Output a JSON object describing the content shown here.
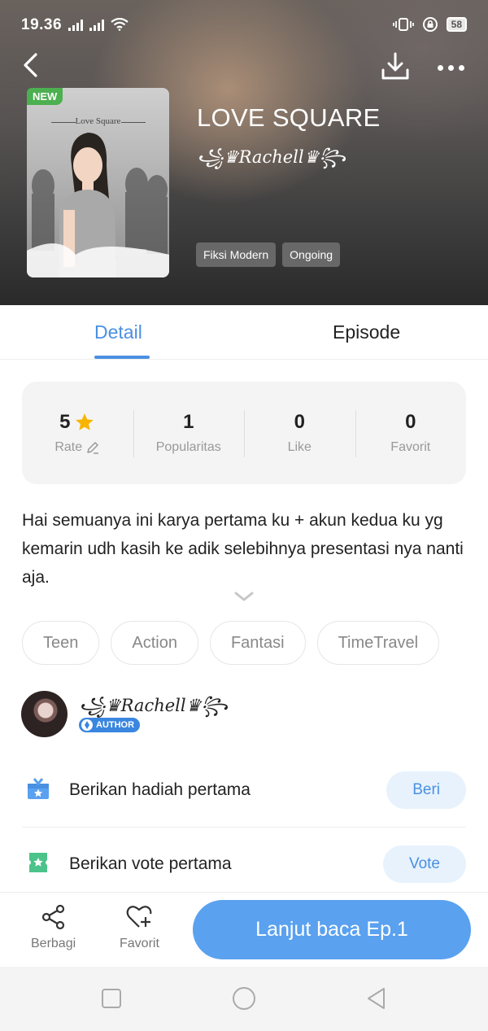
{
  "status_bar": {
    "time": "19.36",
    "battery": "58"
  },
  "header": {
    "back_icon": "chevron-left-icon",
    "download_icon": "download-icon",
    "more_icon": "more-horizontal-icon",
    "new_badge": "NEW",
    "cover_text": "Love Square",
    "title": "LOVE SQUARE",
    "author": "꧁♛Rachell♛꧂",
    "tags": [
      "Fiksi Modern",
      "Ongoing"
    ]
  },
  "tabs": [
    {
      "label": "Detail",
      "active": true
    },
    {
      "label": "Episode",
      "active": false
    }
  ],
  "stats": [
    {
      "value": "5",
      "label": "Rate",
      "icon": "star-icon"
    },
    {
      "value": "1",
      "label": "Popularitas"
    },
    {
      "value": "0",
      "label": "Like"
    },
    {
      "value": "0",
      "label": "Favorit"
    }
  ],
  "description": "Hai semuanya ini karya pertama ku + akun kedua ku yg kemarin udh kasih ke adik selebihnya presentasi nya nanti aja.",
  "genres": [
    "Teen",
    "Action",
    "Fantasi",
    "TimeTravel"
  ],
  "author": {
    "name": "꧁♛Rachell♛꧂",
    "badge": "AUTHOR"
  },
  "actions": [
    {
      "label": "Berikan hadiah pertama",
      "button": "Beri",
      "icon": "gift-icon"
    },
    {
      "label": "Berikan vote pertama",
      "button": "Vote",
      "icon": "ticket-icon"
    }
  ],
  "bottom_bar": {
    "share_label": "Berbagi",
    "favorite_label": "Favorit",
    "continue_label": "Lanjut baca Ep.1"
  },
  "colors": {
    "accent": "#4a90e2",
    "button_primary": "#5aa1ef",
    "new_badge": "#4caf50"
  }
}
